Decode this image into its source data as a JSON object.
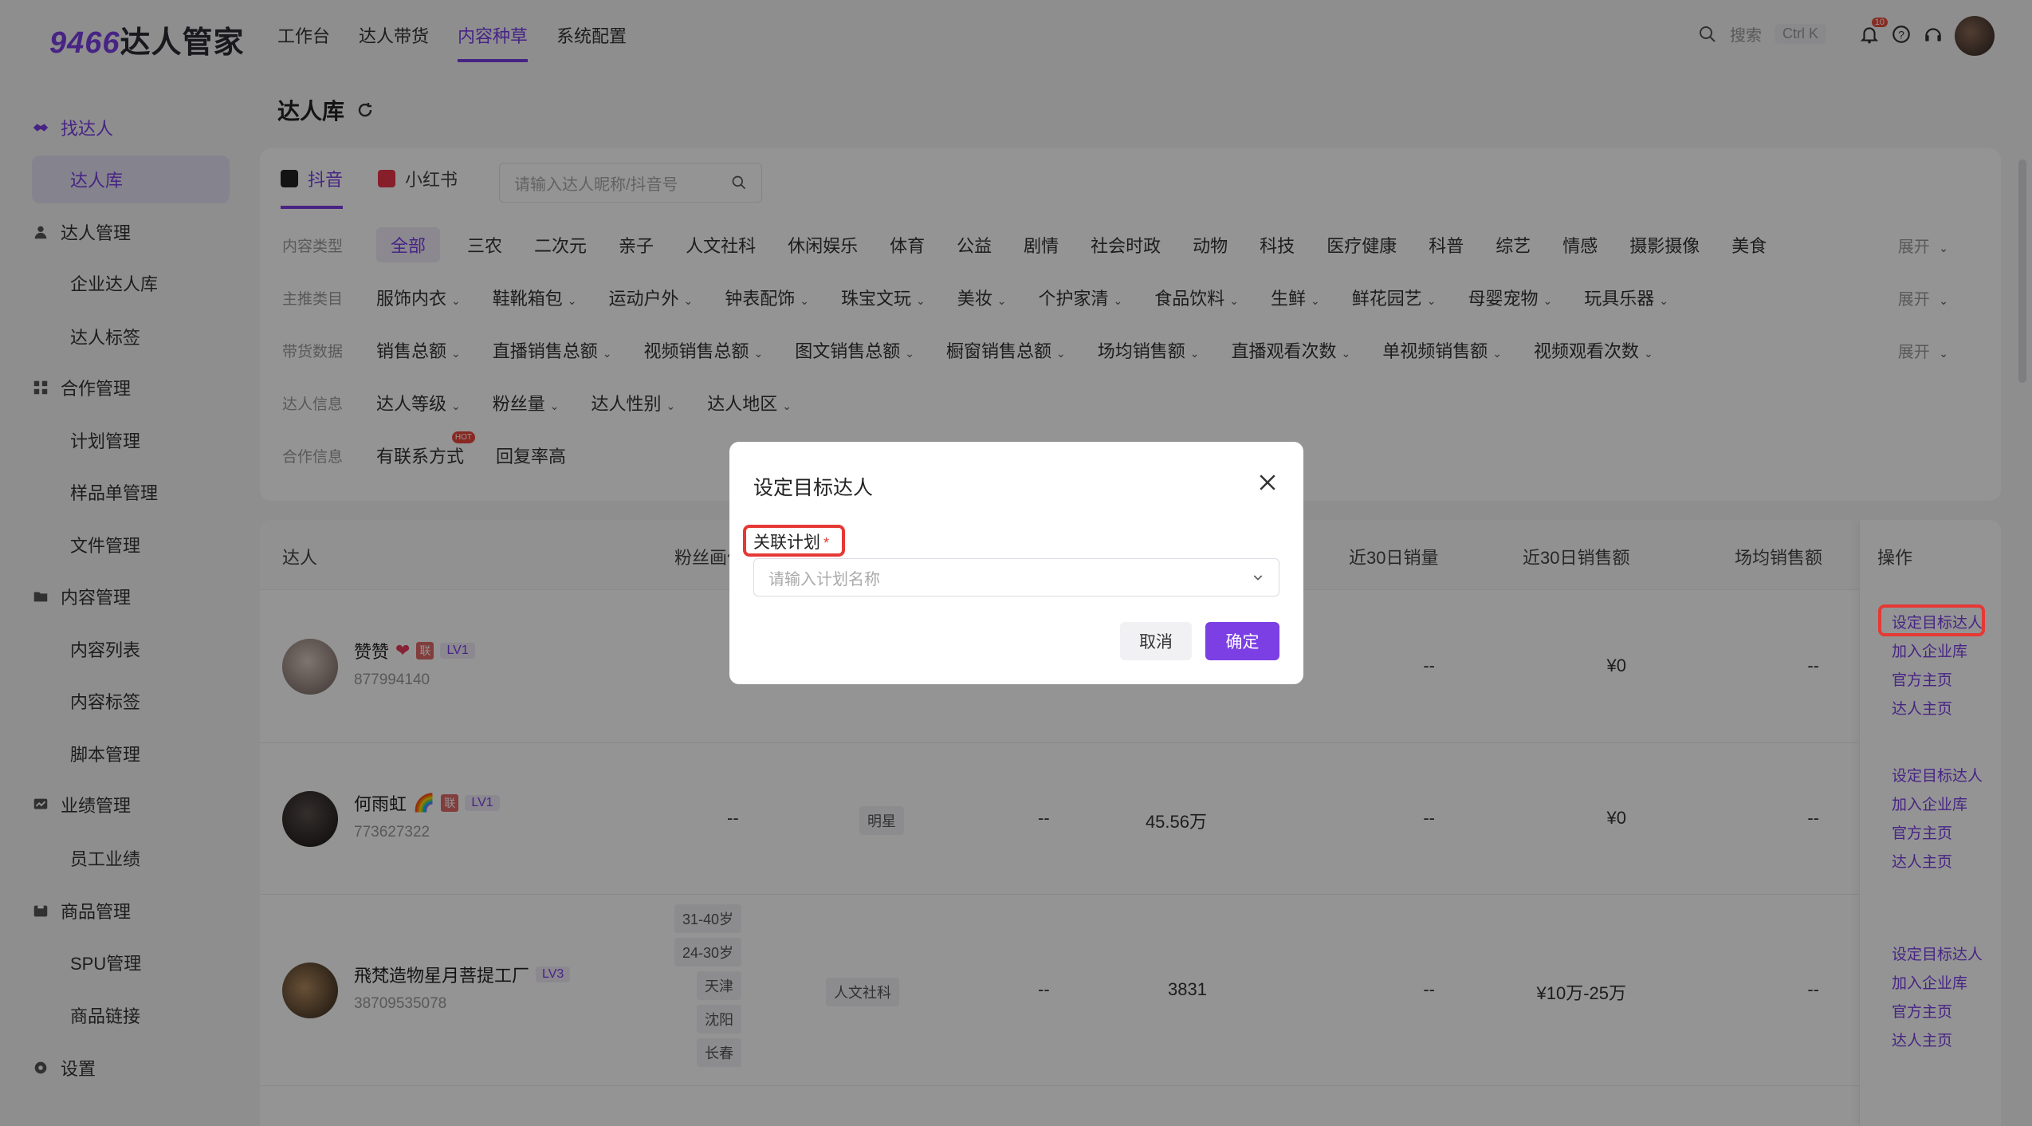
{
  "brand": {
    "num": "9466",
    "name": "达人管家"
  },
  "topnav": [
    "工作台",
    "达人带货",
    "内容种草",
    "系统配置"
  ],
  "topnav_active": 2,
  "search": {
    "label": "搜索",
    "shortcut": "Ctrl K"
  },
  "notif_count": "10",
  "sidebar": [
    {
      "label": "找达人",
      "type": "group",
      "icon": "handshake-icon"
    },
    {
      "label": "达人库",
      "type": "active"
    },
    {
      "label": "达人管理",
      "type": "group",
      "icon": "user-icon"
    },
    {
      "label": "企业达人库",
      "type": "sub"
    },
    {
      "label": "达人标签",
      "type": "sub"
    },
    {
      "label": "合作管理",
      "type": "group",
      "icon": "grid-icon"
    },
    {
      "label": "计划管理",
      "type": "sub"
    },
    {
      "label": "样品单管理",
      "type": "sub"
    },
    {
      "label": "文件管理",
      "type": "sub"
    },
    {
      "label": "内容管理",
      "type": "group",
      "icon": "folder-icon"
    },
    {
      "label": "内容列表",
      "type": "sub"
    },
    {
      "label": "内容标签",
      "type": "sub"
    },
    {
      "label": "脚本管理",
      "type": "sub"
    },
    {
      "label": "业绩管理",
      "type": "group",
      "icon": "chart-icon"
    },
    {
      "label": "员工业绩",
      "type": "sub"
    },
    {
      "label": "商品管理",
      "type": "group",
      "icon": "box-icon"
    },
    {
      "label": "SPU管理",
      "type": "sub"
    },
    {
      "label": "商品链接",
      "type": "sub"
    },
    {
      "label": "设置",
      "type": "group",
      "icon": "gear-icon"
    }
  ],
  "page_title": "达人库",
  "platform_tabs": [
    "抖音",
    "小红书"
  ],
  "search_input_placeholder": "请输入达人昵称/抖音号",
  "filters": [
    {
      "label": "内容类型",
      "chips": [
        "全部",
        "三农",
        "二次元",
        "亲子",
        "人文社科",
        "休闲娱乐",
        "体育",
        "公益",
        "剧情",
        "社会时政",
        "动物",
        "科技",
        "医疗健康",
        "科普",
        "综艺",
        "情感",
        "摄影摄像",
        "美食"
      ],
      "dropdown": false,
      "expand": "展开"
    },
    {
      "label": "主推类目",
      "chips": [
        "服饰内衣",
        "鞋靴箱包",
        "运动户外",
        "钟表配饰",
        "珠宝文玩",
        "美妆",
        "个护家清",
        "食品饮料",
        "生鲜",
        "鲜花园艺",
        "母婴宠物",
        "玩具乐器"
      ],
      "dropdown": true,
      "expand": "展开"
    },
    {
      "label": "带货数据",
      "chips": [
        "销售总额",
        "直播销售总额",
        "视频销售总额",
        "图文销售总额",
        "橱窗销售总额",
        "场均销售额",
        "直播观看次数",
        "单视频销售额",
        "视频观看次数"
      ],
      "dropdown": true,
      "expand": "展开"
    },
    {
      "label": "达人信息",
      "chips": [
        "达人等级",
        "粉丝量",
        "达人性别",
        "达人地区"
      ],
      "dropdown": true,
      "expand": ""
    },
    {
      "label": "合作信息",
      "chips": [
        "有联系方式",
        "回复率高"
      ],
      "dropdown": false,
      "expand": ""
    }
  ],
  "hot_badge": "HOT",
  "table": {
    "headers": {
      "kol": "达人",
      "fans": "粉丝画像",
      "sales30": "近30日销量",
      "gmv30": "近30日销售额",
      "avg": "场均销售额",
      "op": "操作"
    },
    "rows": [
      {
        "name": "赞赞",
        "emoji": "❤",
        "lian": "联",
        "lv": "LV1",
        "id": "877994140",
        "fans_tags": [],
        "cat": "",
        "c1": "",
        "c2": "",
        "sales30": "--",
        "gmv30": "¥0",
        "avg": "--"
      },
      {
        "name": "何雨虹",
        "emoji": "🌈",
        "lian": "联",
        "lv": "LV1",
        "id": "773627322",
        "fans_tags": [
          "--"
        ],
        "cat": "明星",
        "c1": "--",
        "c2": "45.56万",
        "sales30": "--",
        "gmv30": "¥0",
        "avg": "--"
      },
      {
        "name": "飛梵造物星月菩提工厂",
        "emoji": "",
        "lian": "",
        "lv": "LV3",
        "id": "38709535078",
        "fans_tags": [
          "31-40岁",
          "24-30岁",
          "天津",
          "沈阳",
          "长春"
        ],
        "cat": "人文社科",
        "c1": "--",
        "c2": "3831",
        "sales30": "--",
        "gmv30": "¥10万-25万",
        "avg": "--"
      }
    ],
    "ops": [
      "设定目标达人",
      "加入企业库",
      "官方主页",
      "达人主页"
    ]
  },
  "modal": {
    "title": "设定目标达人",
    "field_label": "关联计划",
    "required_mark": "*",
    "select_placeholder": "请输入计划名称",
    "cancel": "取消",
    "confirm": "确定"
  },
  "colors": {
    "accent": "#7b3fe4",
    "highlight": "#e53935"
  }
}
